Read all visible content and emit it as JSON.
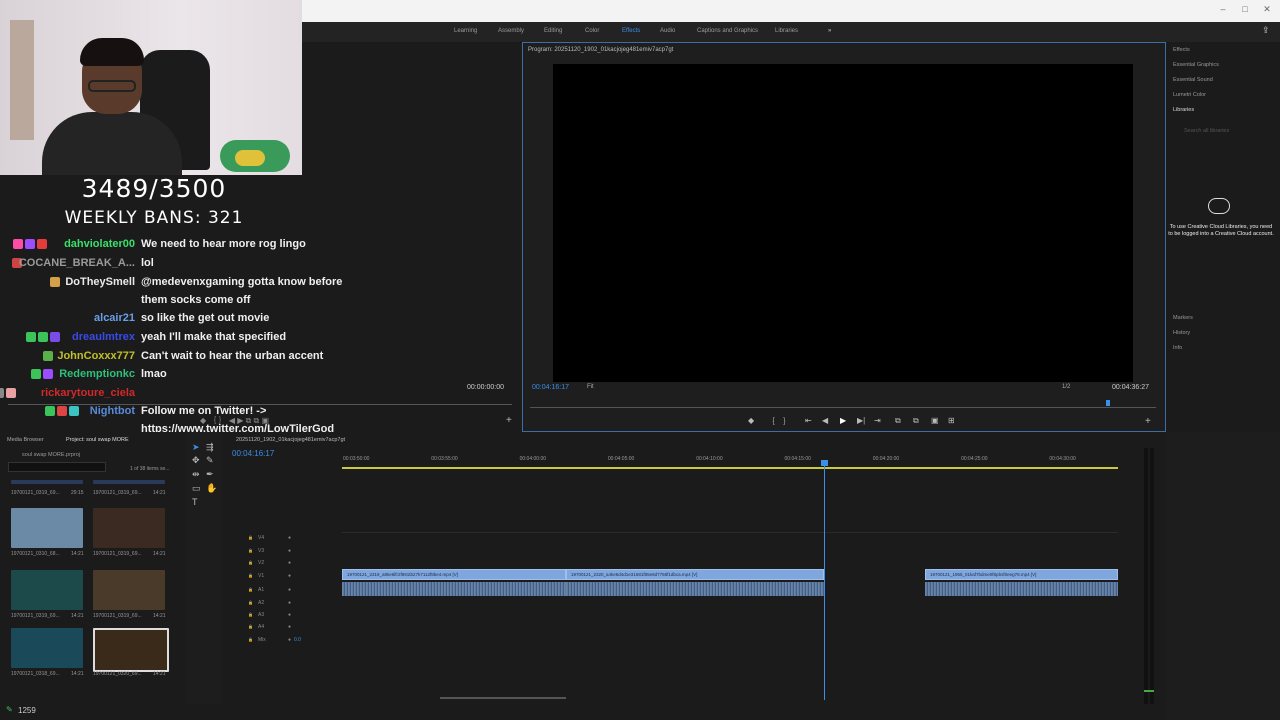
{
  "workspaces": {
    "tabs": [
      "Learning",
      "Assembly",
      "Editing",
      "Color",
      "Effects",
      "Audio",
      "Captions and Graphics",
      "Libraries"
    ],
    "active": "Effects",
    "more": "»"
  },
  "overlay": {
    "counter": "3489/3500",
    "weekly_bans": "WEEKLY BANS: 321"
  },
  "chat": [
    {
      "user": "dahviolater00",
      "color": "#39e06a",
      "message": "We need to hear more rog lingo",
      "badges": [
        "#ff4da6",
        "#9b4dff",
        "#e23c3c"
      ]
    },
    {
      "user": "COCANE_BREAK_A...",
      "color": "#9a9a9a",
      "message": "lol",
      "badges": [
        "#c44"
      ]
    },
    {
      "user": "DoTheySmell",
      "color": "#eaeaea",
      "message": "@medevenxgaming gotta know before",
      "badges": [
        "#d4a04a"
      ]
    },
    {
      "user": "",
      "color": "#eaeaea",
      "message": "them socks come off",
      "badges": []
    },
    {
      "user": "alcair21",
      "color": "#6a9ee8",
      "message": "so like the get out movie",
      "badges": []
    },
    {
      "user": "dreaulmtrex",
      "color": "#3a4ae8",
      "message": "yeah I'll make that specified",
      "badges": [
        "#3cc45a",
        "#3cc45a",
        "#7a4de8"
      ]
    },
    {
      "user": "JohnCoxxx777",
      "color": "#c0c02a",
      "message": "Can't wait to hear the urban accent",
      "badges": [
        "#5ab04a"
      ]
    },
    {
      "user": "Redemptionkc",
      "color": "#2ec07a",
      "message": "lmao",
      "badges": [
        "#3cc45a",
        "#9b4dff"
      ]
    },
    {
      "user": "rickarytoure_ciela",
      "color": "#d02a2a",
      "message": "",
      "badges": [
        "#888",
        "#e8a2a2"
      ]
    },
    {
      "user": "Nightbot",
      "color": "#5a8ad8",
      "message": "Follow me on Twitter! ->",
      "badges": [
        "#3cc45a",
        "#d44",
        "#3cc4c4"
      ]
    },
    {
      "user": "",
      "color": "#eaeaea",
      "message": "https://www.twitter.com/LowTilerGod",
      "badges": []
    }
  ],
  "source_monitor": {
    "timecode": "00:00:00:00"
  },
  "program_monitor": {
    "title": "Program: 20251120_1902_01kacjojeg481emiv7acp7gt",
    "timecode": "00:04:16:17",
    "fit": "Fit",
    "resolution": "1/2",
    "duration": "00:04:36:27"
  },
  "right_panel": {
    "items": [
      "Effects",
      "Essential Graphics",
      "Essential Sound",
      "Lumetri Color",
      "Libraries"
    ],
    "search_placeholder": "Search all libraries",
    "cc_message": "To use Creative Cloud Libraries, you need to be logged into a Creative Cloud account.",
    "bottom_items": [
      "Markers",
      "History",
      "Info"
    ]
  },
  "project": {
    "tabs": [
      "Media Browser",
      "Project: soul swap MORE"
    ],
    "path": "soul swap MORE.prproj",
    "count": "1 of 38 items se...",
    "thumbs": [
      {
        "label": "19700121_0319_69...",
        "dur": "29:15",
        "color": "#2a3a5a"
      },
      {
        "label": "19700121_0319_69...",
        "dur": "14:21",
        "color": "#2a3a5a"
      },
      {
        "label": "19700121_0310_68...",
        "dur": "14:21",
        "color": "#6a8aa5"
      },
      {
        "label": "19700121_0319_69...",
        "dur": "14:21",
        "color": "#3a2a22"
      },
      {
        "label": "19700121_0319_69...",
        "dur": "14:21",
        "color": "#1c4a4a"
      },
      {
        "label": "19700121_0319_69...",
        "dur": "14:21",
        "color": "#4a3a2a"
      },
      {
        "label": "19700121_0318_69...",
        "dur": "14:21",
        "color": "#1a4a5a"
      },
      {
        "label": "19700121_0320_69...",
        "dur": "14:21",
        "color": "#3a2a1a"
      }
    ]
  },
  "timeline": {
    "sequence": "20251120_1902_01kacjojeg481emiv7acp7gt",
    "timecode": "00:04:16:17",
    "ticks": [
      "00:03:50:00",
      "00:03:55:00",
      "00:04:00:00",
      "00:04:05:00",
      "00:04:10:00",
      "00:04:15:00",
      "00:04:20:00",
      "00:04:25:00",
      "00:04:30:00"
    ],
    "tracks": [
      "V4",
      "V3",
      "V2",
      "V1",
      "A1",
      "A2",
      "A3",
      "A4",
      "Mix"
    ],
    "mix_value": "0.0",
    "clips": [
      "19700121_2319_a8ke6lfr2f891tb27k7112f8be4.mp4 [V]",
      "19700121_2320_a4ke6d4d1e31681f85e8d7758f1dbca.mp4 [V]",
      "19700121_1955_01kaf7bdme0f8pbsf0eeg78.mp4 [V]"
    ]
  },
  "status": {
    "number": "1259"
  }
}
